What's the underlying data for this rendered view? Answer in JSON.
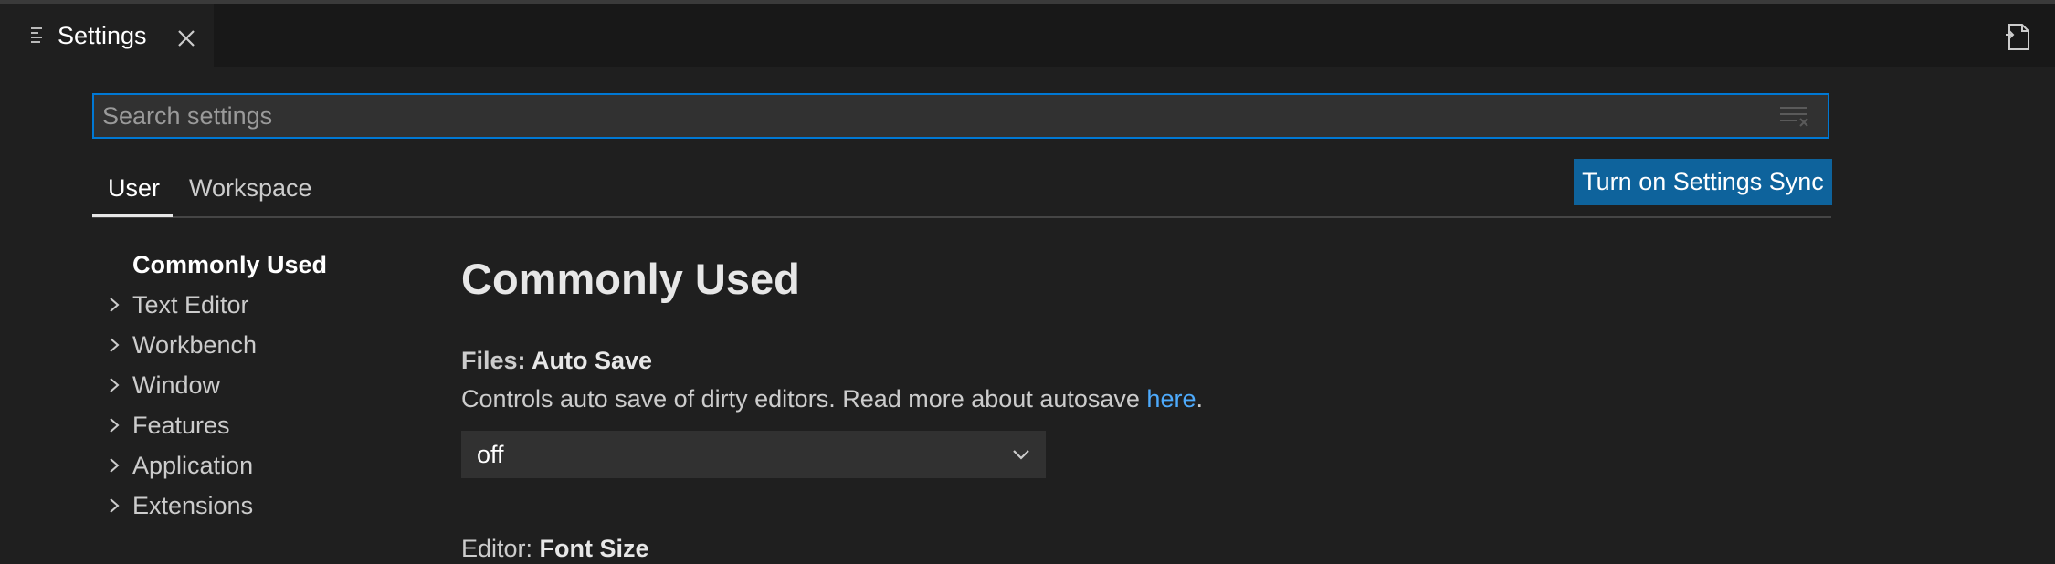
{
  "editor_tab": {
    "title": "Settings",
    "icon": "settings-editor-icon",
    "close_icon": "close-icon"
  },
  "header_actions": {
    "open_json_icon": "open-settings-json-icon"
  },
  "search": {
    "placeholder": "Search settings",
    "value": "",
    "filter_icon": "clear-filter-icon"
  },
  "scope_tabs": {
    "user": "User",
    "workspace": "Workspace",
    "active": "User"
  },
  "sync_button": {
    "label": "Turn on Settings Sync",
    "color": "#0e639c"
  },
  "toc": {
    "items": [
      {
        "label": "Commonly Used",
        "expandable": false,
        "active": true
      },
      {
        "label": "Text Editor",
        "expandable": true
      },
      {
        "label": "Workbench",
        "expandable": true
      },
      {
        "label": "Window",
        "expandable": true
      },
      {
        "label": "Features",
        "expandable": true
      },
      {
        "label": "Application",
        "expandable": true
      },
      {
        "label": "Extensions",
        "expandable": true
      }
    ]
  },
  "main": {
    "section_title": "Commonly Used",
    "auto_save": {
      "category": "Files: ",
      "name": "Auto Save",
      "description": "Controls auto save of dirty editors. Read more about autosave ",
      "link_text": "here",
      "description_end": ".",
      "value": "off"
    },
    "next_setting": {
      "category": "Editor: ",
      "name": "Font Size"
    }
  },
  "colors": {
    "background": "#1f1f1f",
    "tabbar": "#181818",
    "accent": "#0078d4",
    "link": "#4daafc"
  }
}
